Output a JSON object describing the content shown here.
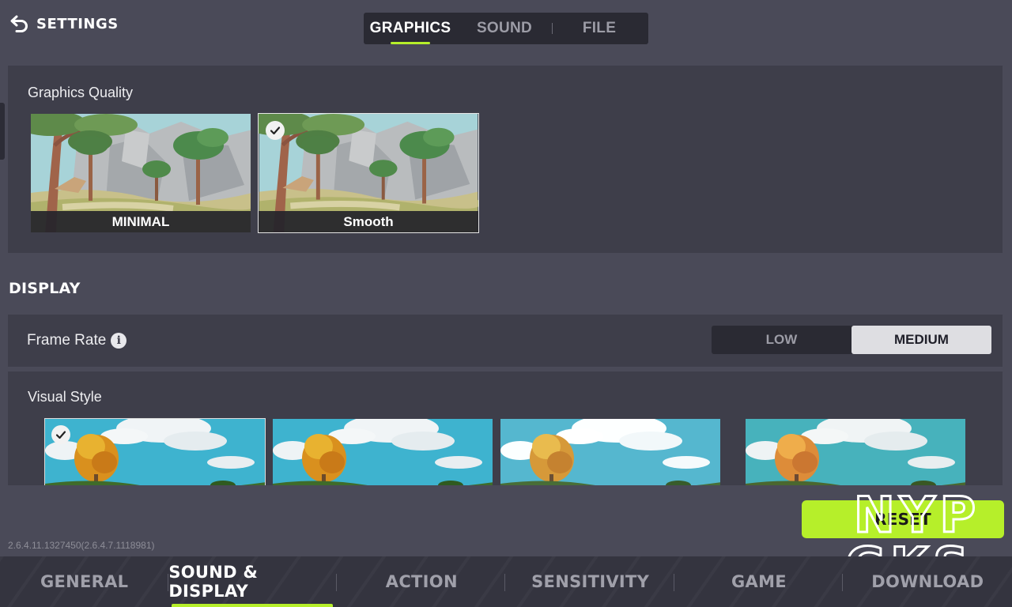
{
  "header": {
    "back_label": "SETTINGS",
    "tabs": [
      {
        "label": "GRAPHICS",
        "active": true
      },
      {
        "label": "SOUND",
        "active": false
      },
      {
        "label": "FILE",
        "active": false
      }
    ]
  },
  "graphics_quality": {
    "label": "Graphics Quality",
    "options": [
      {
        "label": "MINIMAL",
        "selected": false
      },
      {
        "label": "Smooth",
        "selected": true
      }
    ]
  },
  "display": {
    "title": "DISPLAY",
    "frame_rate": {
      "label": "Frame Rate",
      "options": [
        {
          "label": "LOW",
          "active": false
        },
        {
          "label": "MEDIUM",
          "active": true
        }
      ]
    },
    "visual_style": {
      "label": "Visual Style",
      "selected_index": 0
    }
  },
  "version": "2.6.4.11.1327450(2.6.4.7.1118981)",
  "reset_label": "RESET",
  "bottom_nav": [
    {
      "label": "GENERAL",
      "active": false
    },
    {
      "label": "SOUND & DISPLAY",
      "active": true
    },
    {
      "label": "ACTION",
      "active": false
    },
    {
      "label": "SENSITIVITY",
      "active": false
    },
    {
      "label": "GAME",
      "active": false
    },
    {
      "label": "DOWNLOAD",
      "active": false
    }
  ],
  "watermark": {
    "line1": "NYP",
    "line2": "GKS"
  },
  "colors": {
    "accent": "#b6ef2a",
    "background": "#4a4a58",
    "panel": "#3e3e4a"
  }
}
